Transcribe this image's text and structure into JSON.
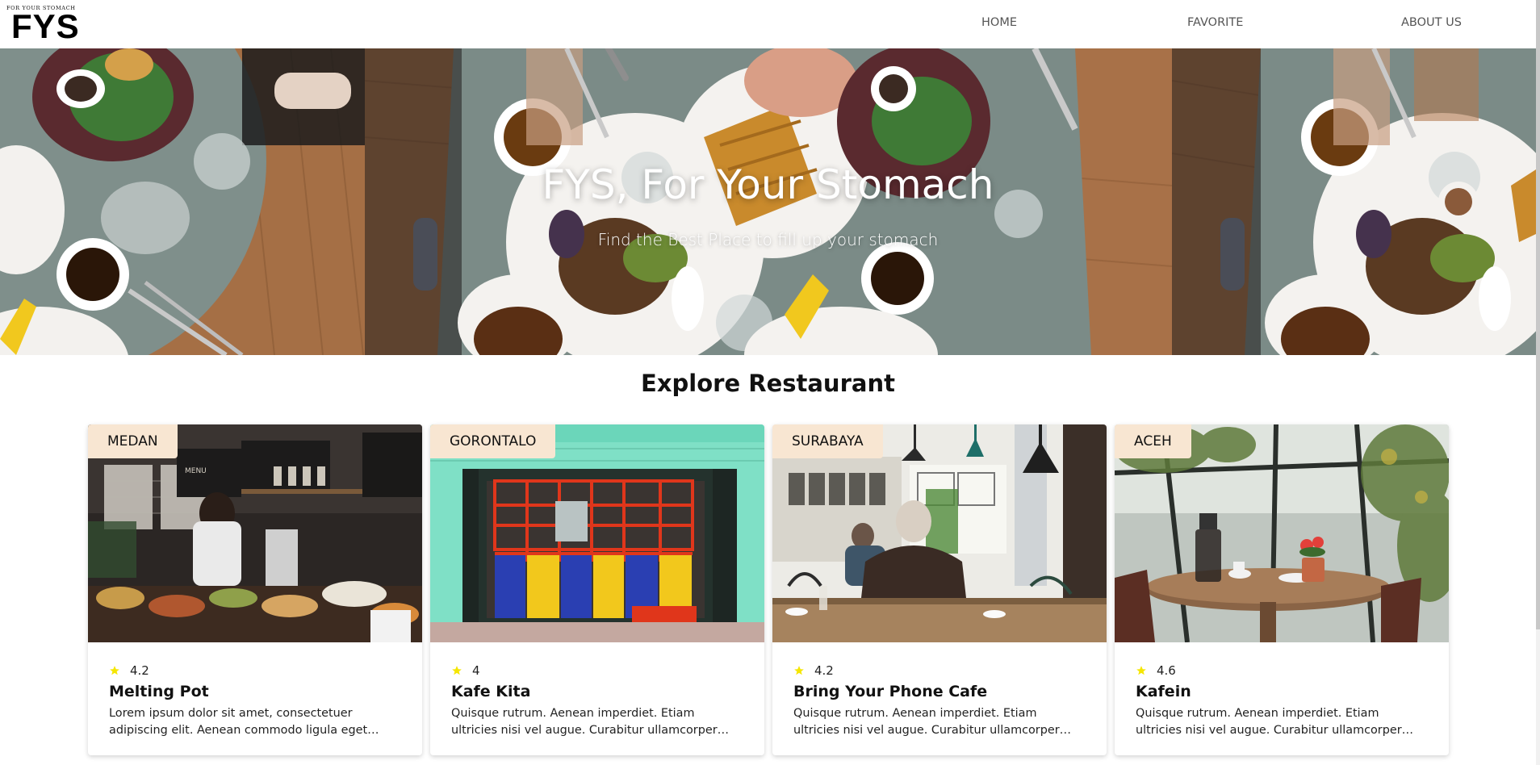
{
  "header": {
    "logo_tagline": "FOR YOUR STOMACH",
    "logo_text": "FYS",
    "nav": [
      {
        "label": "HOME",
        "icon": ""
      },
      {
        "label": "FAVORITE",
        "icon": ""
      },
      {
        "label": "ABOUT US",
        "icon": ""
      }
    ]
  },
  "hero": {
    "title": "FYS, For Your Stomach",
    "subtitle": "Find the Best Place to fill up your stomach",
    "image": "table-of-breakfast-food-photo"
  },
  "explore": {
    "title": "Explore Restaurant",
    "restaurants": [
      {
        "city": "MEDAN",
        "rating": "4.2",
        "name": "Melting Pot",
        "description": "Lorem ipsum dolor sit amet, consectetuer adipiscing elit. Aenean commodo ligula eget dolor. Aenean massa.",
        "image": "cafe-counter-photo"
      },
      {
        "city": "GORONTALO",
        "rating": "4",
        "name": "Kafe Kita",
        "description": "Quisque rutrum. Aenean imperdiet. Etiam ultricies nisi vel augue. Curabitur ullamcorper ultricies nisi. Nam eget dui.",
        "image": "colorful-storefront-photo"
      },
      {
        "city": "SURABAYA",
        "rating": "4.2",
        "name": "Bring Your Phone Cafe",
        "description": "Quisque rutrum. Aenean imperdiet. Etiam ultricies nisi vel augue. Curabitur ullamcorper ultricies nisi. Nam eget dui.",
        "image": "man-sitting-in-cafe-photo"
      },
      {
        "city": "ACEH",
        "rating": "4.6",
        "name": "Kafein",
        "description": "Quisque rutrum. Aenean imperdiet. Etiam ultricies nisi vel augue. Curabitur ullamcorper ultricies nisi. Nam eget dui.",
        "image": "greenhouse-cafe-table-photo"
      }
    ]
  },
  "colors": {
    "badge_bg": "#f8e6d2",
    "star": "#f5e600",
    "text": "#111111",
    "nav_text": "#555555"
  }
}
